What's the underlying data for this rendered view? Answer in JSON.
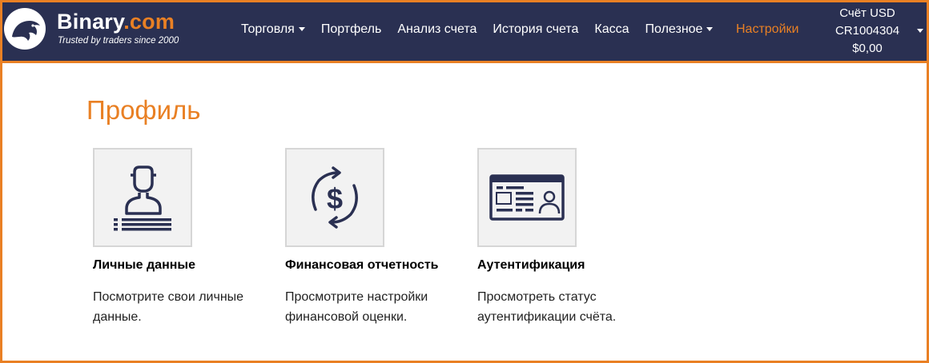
{
  "brand": {
    "name": "Binary",
    "tld": ".com",
    "tagline": "Trusted by traders since 2000"
  },
  "nav": {
    "items": [
      {
        "label": "Торговля",
        "dropdown": true
      },
      {
        "label": "Портфель",
        "dropdown": false
      },
      {
        "label": "Анализ счета",
        "dropdown": false
      },
      {
        "label": "История счета",
        "dropdown": false
      },
      {
        "label": "Касса",
        "dropdown": false
      },
      {
        "label": "Полезное",
        "dropdown": true
      },
      {
        "label": "Настройки",
        "dropdown": false,
        "active": true
      }
    ]
  },
  "account": {
    "type": "Счёт USD",
    "id": "CR1004304",
    "balance": "$0,00"
  },
  "page": {
    "title": "Профиль"
  },
  "cards": [
    {
      "title": "Личные данные",
      "desc": "Посмотрите свои личные данные.",
      "icon": "user-profile-icon"
    },
    {
      "title": "Финансовая отчетность",
      "desc": "Просмотрите настройки финансовой оценки.",
      "icon": "dollar-exchange-icon"
    },
    {
      "title": "Аутентификация",
      "desc": "Просмотреть статус аутентификации счёта.",
      "icon": "id-card-icon"
    }
  ],
  "colors": {
    "navbar": "#2a3052",
    "accent": "#e98024",
    "icon": "#2a3052"
  }
}
